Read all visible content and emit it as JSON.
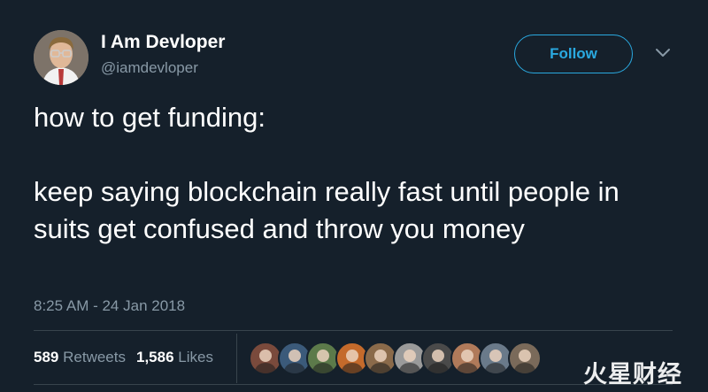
{
  "author": {
    "name": "I Am Devloper",
    "handle": "@iamdevloper"
  },
  "follow_label": "Follow",
  "tweet": {
    "text": "how to get funding:\n\nkeep saying blockchain really fast until people in suits get confused and throw you money",
    "timestamp": "8:25 AM - 24 Jan 2018"
  },
  "stats": {
    "retweets_count": "589",
    "retweets_label": "Retweets",
    "likes_count": "1,586",
    "likes_label": "Likes"
  },
  "likers": [
    {
      "name": "liker-avatar-1",
      "color": "#7a4a3c"
    },
    {
      "name": "liker-avatar-2",
      "color": "#3b5a7a"
    },
    {
      "name": "liker-avatar-3",
      "color": "#5c7a4a"
    },
    {
      "name": "liker-avatar-4",
      "color": "#c46a2b"
    },
    {
      "name": "liker-avatar-5",
      "color": "#8a6a4a"
    },
    {
      "name": "liker-avatar-6",
      "color": "#9a9a9a"
    },
    {
      "name": "liker-avatar-7",
      "color": "#4a4a4a"
    },
    {
      "name": "liker-avatar-8",
      "color": "#b07a5a"
    },
    {
      "name": "liker-avatar-9",
      "color": "#6a7a8a"
    },
    {
      "name": "liker-avatar-10",
      "color": "#7a6a5a"
    }
  ],
  "watermark": "火星财经",
  "colors": {
    "background": "#15202b",
    "accent": "#2aa9e0",
    "secondary_text": "#8899a6"
  }
}
